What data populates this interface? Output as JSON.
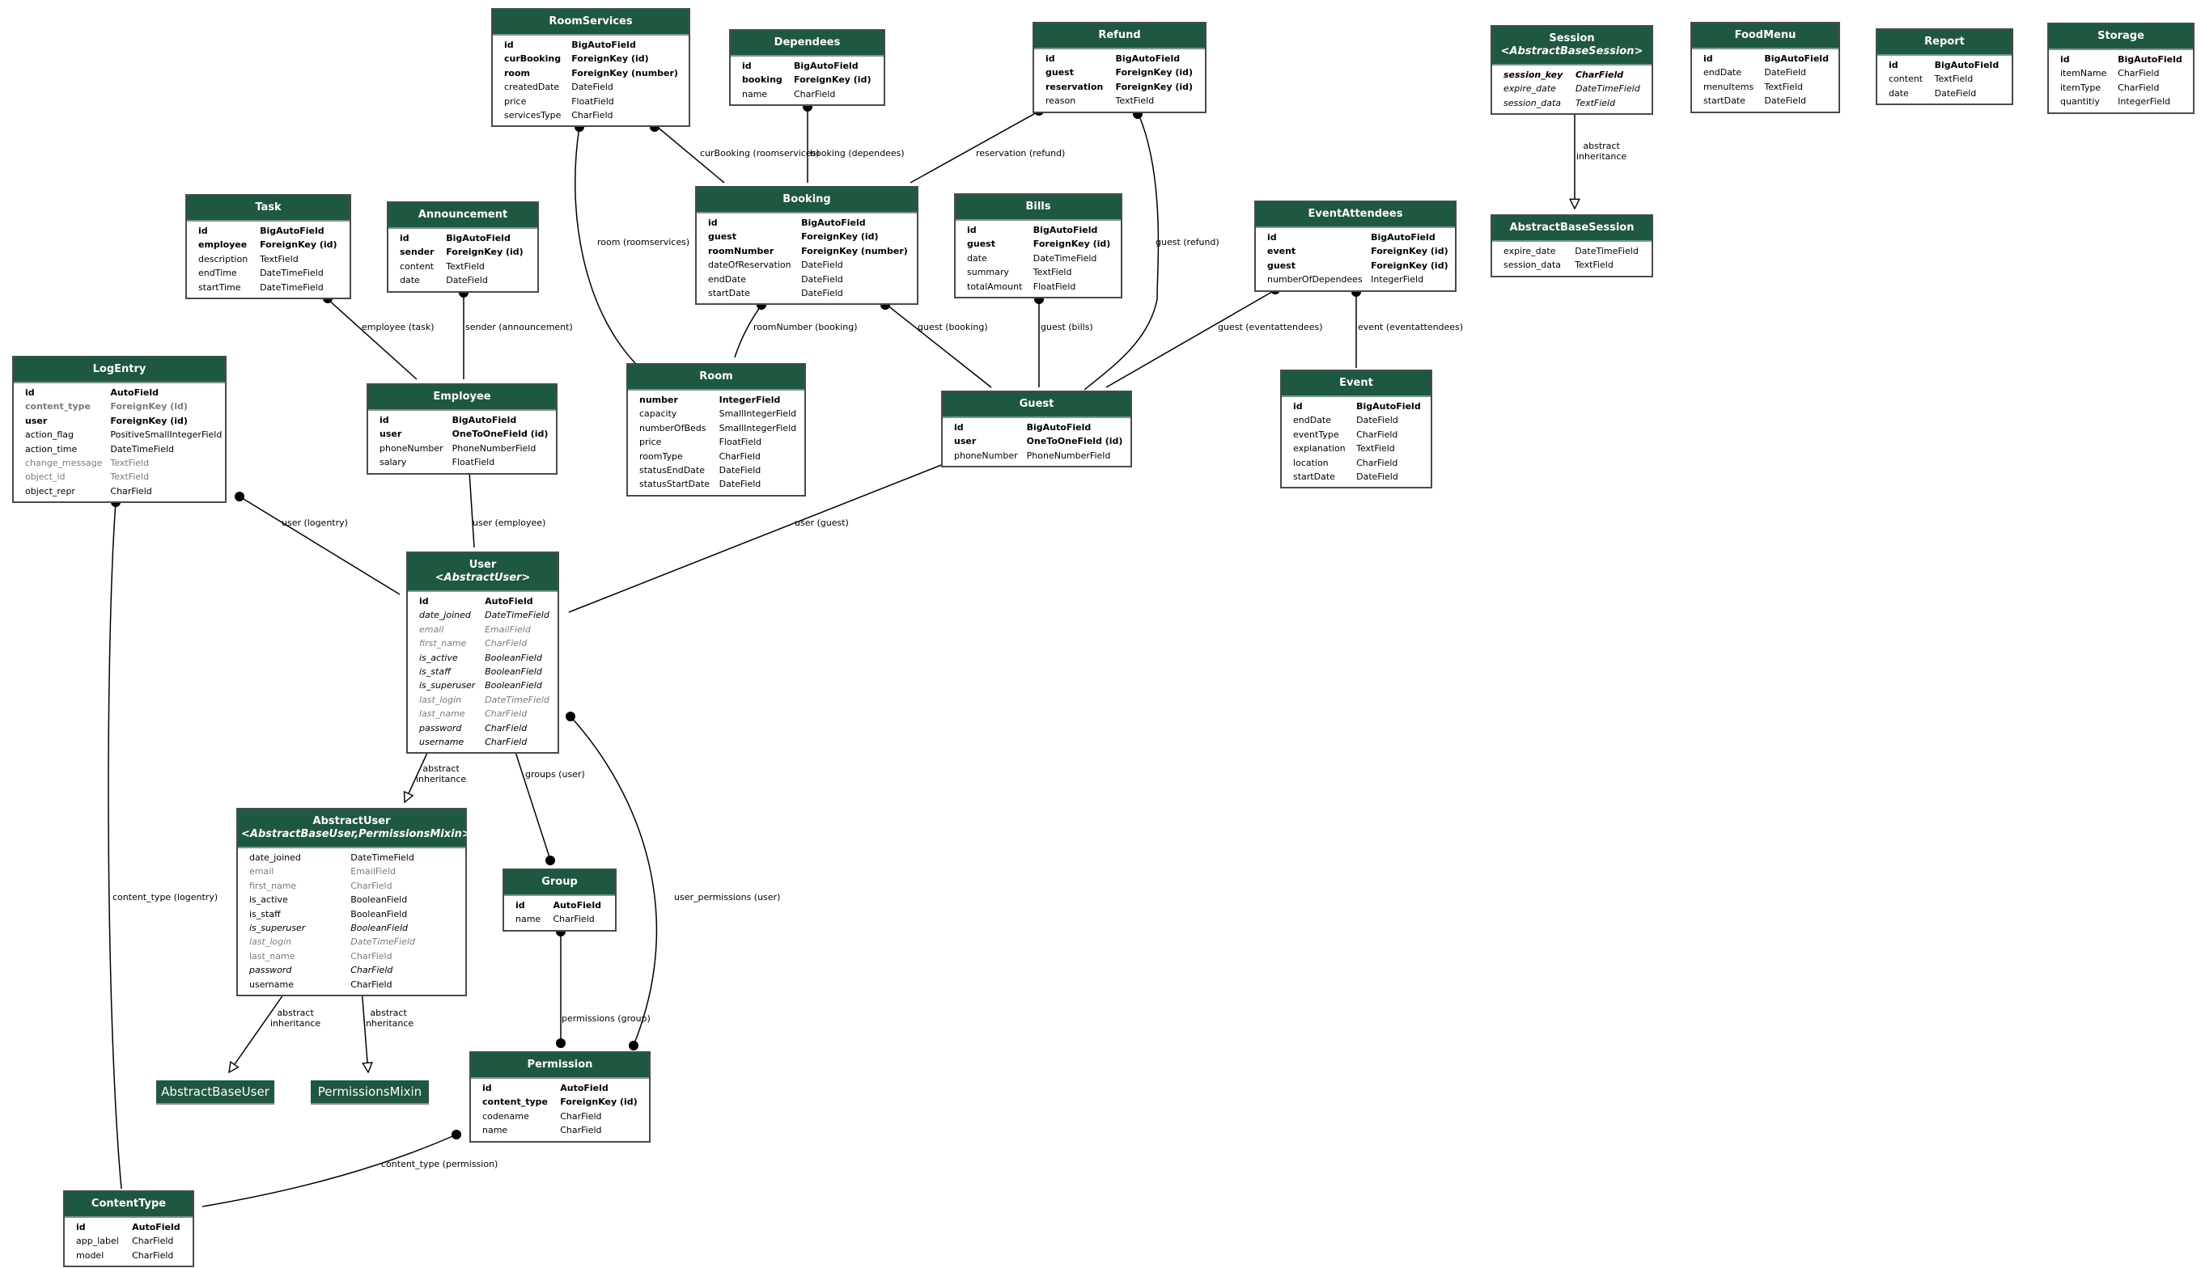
{
  "diagram": {
    "type": "django-model-graph",
    "colors": {
      "header": "#1e5840",
      "header_text": "#ffffff",
      "border": "#4a4a4a",
      "inherited": "#7a7a7a",
      "edge": "#000000"
    }
  },
  "models": {
    "roomservices": {
      "name": "RoomServices",
      "fields": [
        {
          "name": "id",
          "type": "BigAutoField",
          "style": "bold"
        },
        {
          "name": "curBooking",
          "type": "ForeignKey (id)",
          "style": "bold"
        },
        {
          "name": "room",
          "type": "ForeignKey (number)",
          "style": "bold"
        },
        {
          "name": "createdDate",
          "type": "DateField",
          "style": "normal"
        },
        {
          "name": "price",
          "type": "FloatField",
          "style": "normal"
        },
        {
          "name": "servicesType",
          "type": "CharField",
          "style": "normal"
        }
      ]
    },
    "dependees": {
      "name": "Dependees",
      "fields": [
        {
          "name": "id",
          "type": "BigAutoField",
          "style": "bold"
        },
        {
          "name": "booking",
          "type": "ForeignKey (id)",
          "style": "bold"
        },
        {
          "name": "name",
          "type": "CharField",
          "style": "normal"
        }
      ]
    },
    "refund": {
      "name": "Refund",
      "fields": [
        {
          "name": "id",
          "type": "BigAutoField",
          "style": "bold"
        },
        {
          "name": "guest",
          "type": "ForeignKey (id)",
          "style": "bold"
        },
        {
          "name": "reservation",
          "type": "ForeignKey (id)",
          "style": "bold"
        },
        {
          "name": "reason",
          "type": "TextField",
          "style": "normal"
        }
      ]
    },
    "session": {
      "name": "Session",
      "parent": "<AbstractBaseSession>",
      "fields": [
        {
          "name": "session_key",
          "type": "CharField",
          "style": "bold-italic"
        },
        {
          "name": "expire_date",
          "type": "DateTimeField",
          "style": "italic"
        },
        {
          "name": "session_data",
          "type": "TextField",
          "style": "italic"
        }
      ]
    },
    "foodmenu": {
      "name": "FoodMenu",
      "fields": [
        {
          "name": "id",
          "type": "BigAutoField",
          "style": "bold"
        },
        {
          "name": "endDate",
          "type": "DateField",
          "style": "normal"
        },
        {
          "name": "menuItems",
          "type": "TextField",
          "style": "normal"
        },
        {
          "name": "startDate",
          "type": "DateField",
          "style": "normal"
        }
      ]
    },
    "report": {
      "name": "Report",
      "fields": [
        {
          "name": "id",
          "type": "BigAutoField",
          "style": "bold"
        },
        {
          "name": "content",
          "type": "TextField",
          "style": "normal"
        },
        {
          "name": "date",
          "type": "DateField",
          "style": "normal"
        }
      ]
    },
    "storage": {
      "name": "Storage",
      "fields": [
        {
          "name": "id",
          "type": "BigAutoField",
          "style": "bold"
        },
        {
          "name": "itemName",
          "type": "CharField",
          "style": "normal"
        },
        {
          "name": "itemType",
          "type": "CharField",
          "style": "normal"
        },
        {
          "name": "quantitiy",
          "type": "IntegerField",
          "style": "normal"
        }
      ]
    },
    "abstractbasesession": {
      "name": "AbstractBaseSession",
      "fields": [
        {
          "name": "expire_date",
          "type": "DateTimeField",
          "style": "normal"
        },
        {
          "name": "session_data",
          "type": "TextField",
          "style": "normal"
        }
      ]
    },
    "task": {
      "name": "Task",
      "fields": [
        {
          "name": "id",
          "type": "BigAutoField",
          "style": "bold"
        },
        {
          "name": "employee",
          "type": "ForeignKey (id)",
          "style": "bold"
        },
        {
          "name": "description",
          "type": "TextField",
          "style": "normal"
        },
        {
          "name": "endTime",
          "type": "DateTimeField",
          "style": "normal"
        },
        {
          "name": "startTime",
          "type": "DateTimeField",
          "style": "normal"
        }
      ]
    },
    "announcement": {
      "name": "Announcement",
      "fields": [
        {
          "name": "id",
          "type": "BigAutoField",
          "style": "bold"
        },
        {
          "name": "sender",
          "type": "ForeignKey (id)",
          "style": "bold"
        },
        {
          "name": "content",
          "type": "TextField",
          "style": "normal"
        },
        {
          "name": "date",
          "type": "DateField",
          "style": "normal"
        }
      ]
    },
    "booking": {
      "name": "Booking",
      "fields": [
        {
          "name": "id",
          "type": "BigAutoField",
          "style": "bold"
        },
        {
          "name": "guest",
          "type": "ForeignKey (id)",
          "style": "bold"
        },
        {
          "name": "roomNumber",
          "type": "ForeignKey (number)",
          "style": "bold"
        },
        {
          "name": "dateOfReservation",
          "type": "DateField",
          "style": "normal"
        },
        {
          "name": "endDate",
          "type": "DateField",
          "style": "normal"
        },
        {
          "name": "startDate",
          "type": "DateField",
          "style": "normal"
        }
      ]
    },
    "bills": {
      "name": "Bills",
      "fields": [
        {
          "name": "id",
          "type": "BigAutoField",
          "style": "bold"
        },
        {
          "name": "guest",
          "type": "ForeignKey (id)",
          "style": "bold"
        },
        {
          "name": "date",
          "type": "DateTimeField",
          "style": "normal"
        },
        {
          "name": "summary",
          "type": "TextField",
          "style": "normal"
        },
        {
          "name": "totalAmount",
          "type": "FloatField",
          "style": "normal"
        }
      ]
    },
    "eventattendees": {
      "name": "EventAttendees",
      "fields": [
        {
          "name": "id",
          "type": "BigAutoField",
          "style": "bold"
        },
        {
          "name": "event",
          "type": "ForeignKey (id)",
          "style": "bold"
        },
        {
          "name": "guest",
          "type": "ForeignKey (id)",
          "style": "bold"
        },
        {
          "name": "numberOfDependees",
          "type": "IntegerField",
          "style": "normal"
        }
      ]
    },
    "logentry": {
      "name": "LogEntry",
      "fields": [
        {
          "name": "id",
          "type": "AutoField",
          "style": "bold"
        },
        {
          "name": "content_type",
          "type": "ForeignKey (id)",
          "style": "bold-grey"
        },
        {
          "name": "user",
          "type": "ForeignKey (id)",
          "style": "bold"
        },
        {
          "name": "action_flag",
          "type": "PositiveSmallIntegerField",
          "style": "normal"
        },
        {
          "name": "action_time",
          "type": "DateTimeField",
          "style": "normal"
        },
        {
          "name": "change_message",
          "type": "TextField",
          "style": "grey"
        },
        {
          "name": "object_id",
          "type": "TextField",
          "style": "grey"
        },
        {
          "name": "object_repr",
          "type": "CharField",
          "style": "normal"
        }
      ]
    },
    "employee": {
      "name": "Employee",
      "fields": [
        {
          "name": "id",
          "type": "BigAutoField",
          "style": "bold"
        },
        {
          "name": "user",
          "type": "OneToOneField (id)",
          "style": "bold"
        },
        {
          "name": "phoneNumber",
          "type": "PhoneNumberField",
          "style": "normal"
        },
        {
          "name": "salary",
          "type": "FloatField",
          "style": "normal"
        }
      ]
    },
    "room": {
      "name": "Room",
      "fields": [
        {
          "name": "number",
          "type": "IntegerField",
          "style": "bold"
        },
        {
          "name": "capacity",
          "type": "SmallIntegerField",
          "style": "normal"
        },
        {
          "name": "numberOfBeds",
          "type": "SmallIntegerField",
          "style": "normal"
        },
        {
          "name": "price",
          "type": "FloatField",
          "style": "normal"
        },
        {
          "name": "roomType",
          "type": "CharField",
          "style": "normal"
        },
        {
          "name": "statusEndDate",
          "type": "DateField",
          "style": "normal"
        },
        {
          "name": "statusStartDate",
          "type": "DateField",
          "style": "normal"
        }
      ]
    },
    "guest": {
      "name": "Guest",
      "fields": [
        {
          "name": "id",
          "type": "BigAutoField",
          "style": "bold"
        },
        {
          "name": "user",
          "type": "OneToOneField (id)",
          "style": "bold"
        },
        {
          "name": "phoneNumber",
          "type": "PhoneNumberField",
          "style": "normal"
        }
      ]
    },
    "event": {
      "name": "Event",
      "fields": [
        {
          "name": "id",
          "type": "BigAutoField",
          "style": "bold"
        },
        {
          "name": "endDate",
          "type": "DateField",
          "style": "normal"
        },
        {
          "name": "eventType",
          "type": "CharField",
          "style": "normal"
        },
        {
          "name": "explanation",
          "type": "TextField",
          "style": "normal"
        },
        {
          "name": "location",
          "type": "CharField",
          "style": "normal"
        },
        {
          "name": "startDate",
          "type": "DateField",
          "style": "normal"
        }
      ]
    },
    "user": {
      "name": "User",
      "parent": "<AbstractUser>",
      "fields": [
        {
          "name": "id",
          "type": "AutoField",
          "style": "bold"
        },
        {
          "name": "date_joined",
          "type": "DateTimeField",
          "style": "italic"
        },
        {
          "name": "email",
          "type": "EmailField",
          "style": "italic-grey"
        },
        {
          "name": "first_name",
          "type": "CharField",
          "style": "italic-grey"
        },
        {
          "name": "is_active",
          "type": "BooleanField",
          "style": "italic"
        },
        {
          "name": "is_staff",
          "type": "BooleanField",
          "style": "italic"
        },
        {
          "name": "is_superuser",
          "type": "BooleanField",
          "style": "italic"
        },
        {
          "name": "last_login",
          "type": "DateTimeField",
          "style": "italic-grey"
        },
        {
          "name": "last_name",
          "type": "CharField",
          "style": "italic-grey"
        },
        {
          "name": "password",
          "type": "CharField",
          "style": "italic"
        },
        {
          "name": "username",
          "type": "CharField",
          "style": "italic"
        }
      ]
    },
    "abstractuser": {
      "name": "AbstractUser",
      "parent": "<AbstractBaseUser,PermissionsMixin>",
      "fields": [
        {
          "name": "date_joined",
          "type": "DateTimeField",
          "style": "normal"
        },
        {
          "name": "email",
          "type": "EmailField",
          "style": "grey"
        },
        {
          "name": "first_name",
          "type": "CharField",
          "style": "grey"
        },
        {
          "name": "is_active",
          "type": "BooleanField",
          "style": "normal"
        },
        {
          "name": "is_staff",
          "type": "BooleanField",
          "style": "normal"
        },
        {
          "name": "is_superuser",
          "type": "BooleanField",
          "style": "italic"
        },
        {
          "name": "last_login",
          "type": "DateTimeField",
          "style": "italic-grey"
        },
        {
          "name": "last_name",
          "type": "CharField",
          "style": "grey"
        },
        {
          "name": "password",
          "type": "CharField",
          "style": "italic"
        },
        {
          "name": "username",
          "type": "CharField",
          "style": "normal"
        }
      ]
    },
    "group": {
      "name": "Group",
      "fields": [
        {
          "name": "id",
          "type": "AutoField",
          "style": "bold"
        },
        {
          "name": "name",
          "type": "CharField",
          "style": "normal"
        }
      ]
    },
    "permission": {
      "name": "Permission",
      "fields": [
        {
          "name": "id",
          "type": "AutoField",
          "style": "bold"
        },
        {
          "name": "content_type",
          "type": "ForeignKey (id)",
          "style": "bold"
        },
        {
          "name": "codename",
          "type": "CharField",
          "style": "normal"
        },
        {
          "name": "name",
          "type": "CharField",
          "style": "normal"
        }
      ]
    },
    "contenttype": {
      "name": "ContentType",
      "fields": [
        {
          "name": "id",
          "type": "AutoField",
          "style": "bold"
        },
        {
          "name": "app_label",
          "type": "CharField",
          "style": "normal"
        },
        {
          "name": "model",
          "type": "CharField",
          "style": "normal"
        }
      ]
    }
  },
  "simple_nodes": {
    "abstractbaseuser": "AbstractBaseUser",
    "permissionsmixin": "PermissionsMixin"
  },
  "edge_labels": {
    "curbooking_roomservices": "curBooking (roomservices)",
    "booking_dependees": "booking (dependees)",
    "reservation_refund": "reservation (refund)",
    "room_roomservices": "room (roomservices)",
    "guest_refund": "guest (refund)",
    "employee_task": "employee (task)",
    "sender_announcement": "sender (announcement)",
    "roomnumber_booking": "roomNumber (booking)",
    "guest_booking": "guest (booking)",
    "guest_bills": "guest (bills)",
    "guest_eventattendees": "guest (eventattendees)",
    "event_eventattendees": "event (eventattendees)",
    "user_logentry": "user (logentry)",
    "user_employee": "user (employee)",
    "user_guest": "user (guest)",
    "groups_user": "groups (user)",
    "user_permissions_user": "user_permissions (user)",
    "permissions_group": "permissions (group)",
    "content_type_logentry": "content_type (logentry)",
    "content_type_permission": "content_type (permission)",
    "abstract_inheritance": "abstract\ninheritance"
  }
}
